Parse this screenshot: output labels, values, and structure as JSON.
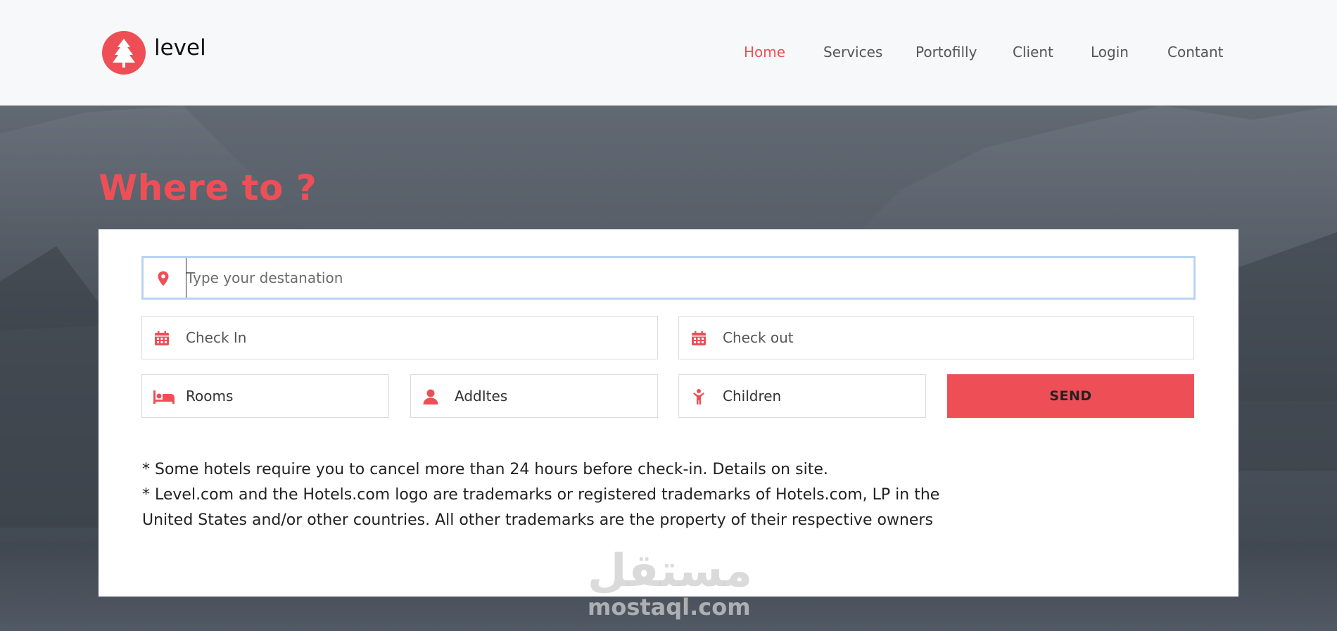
{
  "header": {
    "brand": "level",
    "nav": [
      {
        "label": "Home",
        "active": true
      },
      {
        "label": "Services",
        "active": false
      },
      {
        "label": "Portofilly",
        "active": false
      },
      {
        "label": "Client",
        "active": false
      },
      {
        "label": "Login",
        "active": false
      },
      {
        "label": "Contant",
        "active": false
      }
    ]
  },
  "hero": {
    "title": "Where to ?"
  },
  "form": {
    "destination_placeholder": "Type your destanation",
    "check_in": "Check In",
    "check_out": "Check out",
    "rooms": "Rooms",
    "adults": "AddItes",
    "children": "Children",
    "send_label": "SEND",
    "icons": {
      "destination": "map-pin-icon",
      "check_in": "calendar-icon",
      "check_out": "calendar-icon",
      "rooms": "bed-icon",
      "adults": "user-icon",
      "children": "child-icon"
    }
  },
  "notes": [
    "* Some hotels require you to cancel more than 24 hours before check-in. Details on site.",
    "* Level.com and the Hotels.com logo are trademarks or registered trademarks of Hotels.com, LP in the United States and/or other countries. All other trademarks are the property of their respective owners"
  ],
  "watermark": {
    "arabic": "مستقل",
    "latin": "mostaql.com"
  },
  "colors": {
    "accent": "#ee4f57",
    "focus_border": "#b8d4f5",
    "hero_overlay": "#4a5360"
  }
}
